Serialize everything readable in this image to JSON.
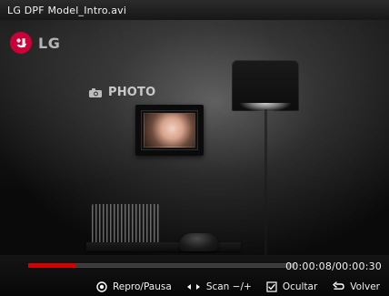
{
  "window": {
    "title": "LG DPF Model_Intro.avi"
  },
  "scene": {
    "brand_text": "LG",
    "photo_text": "PHOTO"
  },
  "playback": {
    "progress_fraction": 0.18,
    "time_text": "00:00:08/00:00:30"
  },
  "hints": [
    {
      "icon": "dot-icon",
      "label": "Repro/Pausa"
    },
    {
      "icon": "left-right-icon",
      "label": "Scan −/+"
    },
    {
      "icon": "checkbox-icon",
      "label": "Ocultar"
    },
    {
      "icon": "return-icon",
      "label": "Volver"
    }
  ],
  "colors": {
    "progress_fill": "#d40000",
    "lg_red": "#d3003a"
  }
}
